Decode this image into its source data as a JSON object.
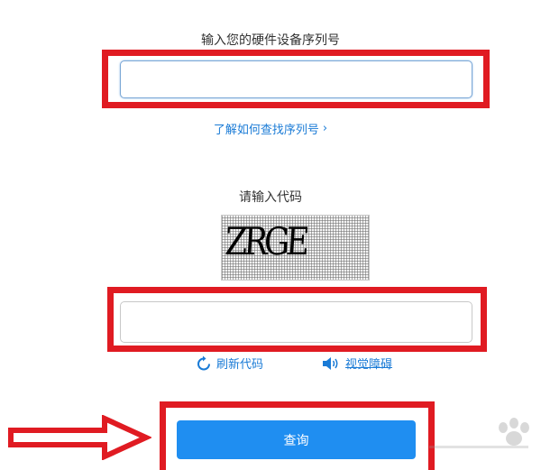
{
  "serial": {
    "label": "输入您的硬件设备序列号",
    "value": "",
    "placeholder": ""
  },
  "help_link": {
    "label": "了解如何查找序列号",
    "chevron": "›"
  },
  "captcha": {
    "label": "请输入代码",
    "image_text": "ZRGE",
    "input_value": "",
    "input_placeholder": ""
  },
  "actions": {
    "refresh_label": "刷新代码",
    "refresh_icon": "refresh-icon",
    "accessibility_label": "视觉障碍",
    "accessibility_icon": "speaker-icon"
  },
  "query_button": {
    "label": "查询"
  },
  "colors": {
    "annotation_red": "#e01b22",
    "link_blue": "#1a7bd6",
    "button_blue": "#1f8ef1"
  }
}
